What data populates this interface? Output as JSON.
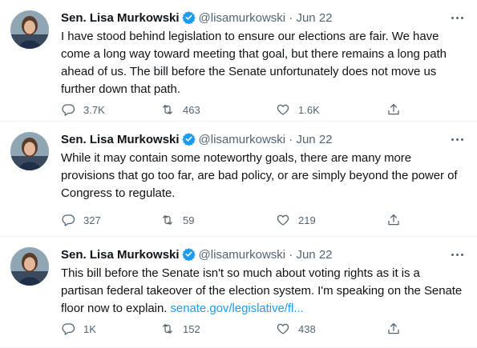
{
  "tweets": [
    {
      "author_name": "Sen. Lisa Murkowski",
      "handle": "@lisamurkowski",
      "date_sep": " · ",
      "date": "Jun 22",
      "text_lines": [
        "I have stood behind legislation to ensure our elections are fair. We have",
        "come a long way toward meeting that goal, but there remains a long path",
        "ahead of us. The bill before the Senate unfortunately does not move us",
        "further down that path."
      ],
      "link_text": "",
      "replies": "3.7K",
      "retweets": "463",
      "likes": "1.6K"
    },
    {
      "author_name": "Sen. Lisa Murkowski",
      "handle": "@lisamurkowski",
      "date_sep": " · ",
      "date": "Jun 22",
      "text_lines": [
        "While it may contain some noteworthy goals, there are many more",
        "provisions that go too far, are bad policy, or are simply beyond the power of",
        "Congress to regulate."
      ],
      "link_text": "",
      "replies": "327",
      "retweets": "59",
      "likes": "219"
    },
    {
      "author_name": "Sen. Lisa Murkowski",
      "handle": "@lisamurkowski",
      "date_sep": " · ",
      "date": "Jun 22",
      "text_lines": [
        "This bill before the Senate isn't so much about voting rights as it is a",
        "partisan federal takeover of the election system. I'm speaking on the Senate",
        "floor now to explain. "
      ],
      "link_text": "senate.gov/legislative/fl...",
      "replies": "1K",
      "retweets": "152",
      "likes": "438"
    }
  ],
  "colors": {
    "text": "#0f1419",
    "secondary": "#536471",
    "link": "#1d9bf0",
    "verified": "#1d9bf0",
    "divider": "#eff3f4"
  },
  "icons": {
    "verified": "verified-badge-icon",
    "more": "more-dots-icon",
    "reply": "reply-bubble-icon",
    "retweet": "retweet-icon",
    "like": "heart-icon",
    "share": "share-upload-icon"
  }
}
